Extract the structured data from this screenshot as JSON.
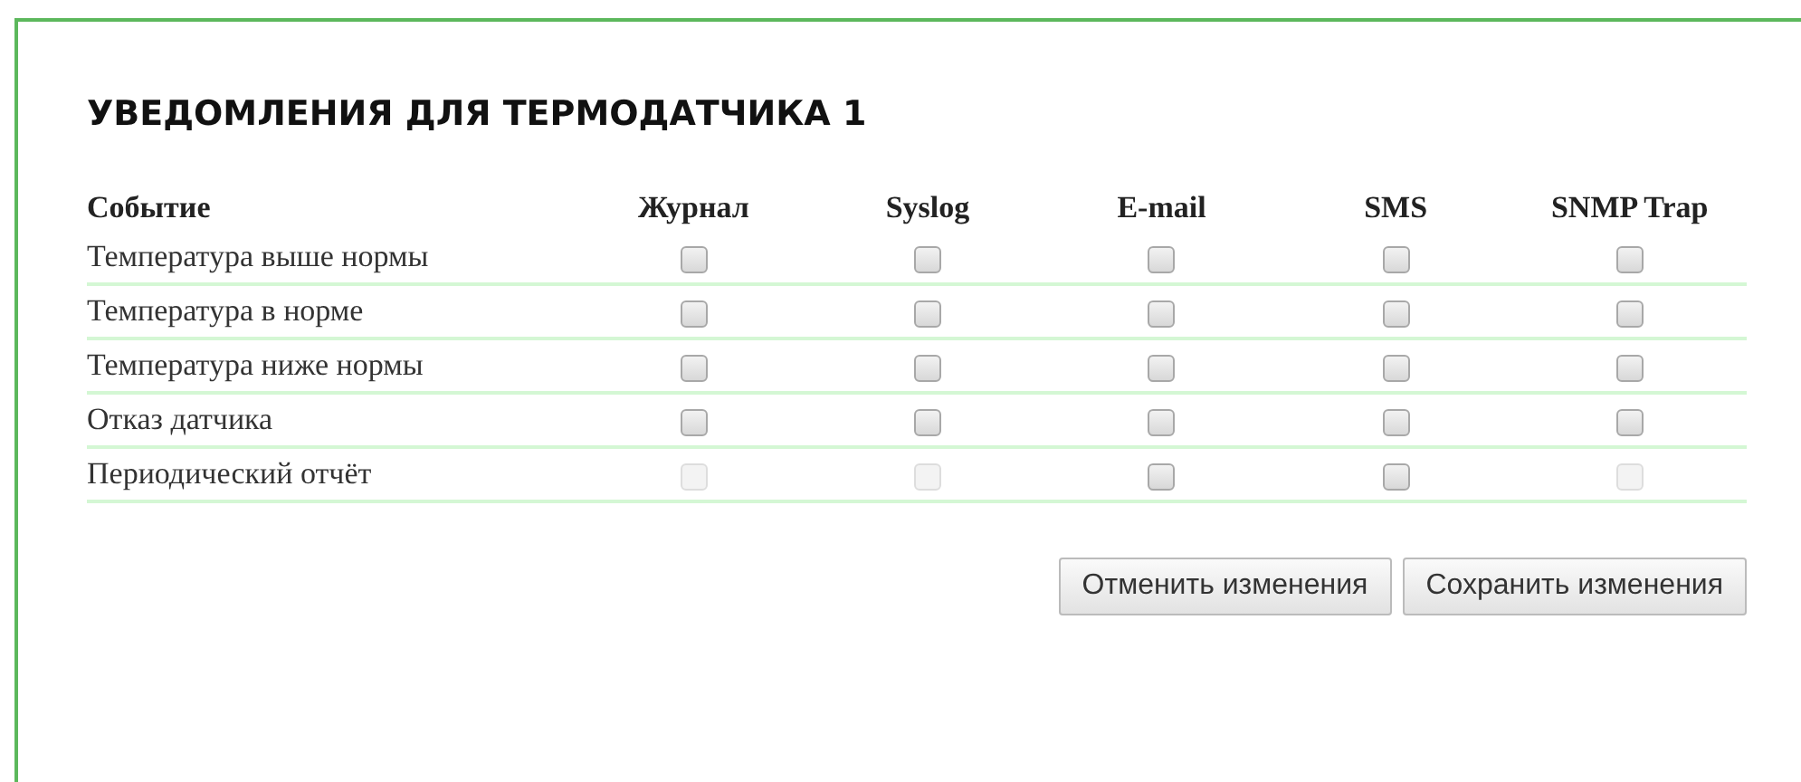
{
  "title": "УВЕДОМЛЕНИЯ ДЛЯ ТЕРМОДАТЧИКА 1",
  "columns": [
    "Событие",
    "Журнал",
    "Syslog",
    "E-mail",
    "SMS",
    "SNMP Trap"
  ],
  "rows": [
    {
      "event": "Температура выше нормы",
      "channels": [
        {
          "checked": false,
          "disabled": false
        },
        {
          "checked": false,
          "disabled": false
        },
        {
          "checked": false,
          "disabled": false
        },
        {
          "checked": false,
          "disabled": false
        },
        {
          "checked": false,
          "disabled": false
        }
      ]
    },
    {
      "event": "Температура в норме",
      "channels": [
        {
          "checked": false,
          "disabled": false
        },
        {
          "checked": false,
          "disabled": false
        },
        {
          "checked": false,
          "disabled": false
        },
        {
          "checked": false,
          "disabled": false
        },
        {
          "checked": false,
          "disabled": false
        }
      ]
    },
    {
      "event": "Температура ниже нормы",
      "channels": [
        {
          "checked": false,
          "disabled": false
        },
        {
          "checked": false,
          "disabled": false
        },
        {
          "checked": false,
          "disabled": false
        },
        {
          "checked": false,
          "disabled": false
        },
        {
          "checked": false,
          "disabled": false
        }
      ]
    },
    {
      "event": "Отказ датчика",
      "channels": [
        {
          "checked": false,
          "disabled": false
        },
        {
          "checked": false,
          "disabled": false
        },
        {
          "checked": false,
          "disabled": false
        },
        {
          "checked": false,
          "disabled": false
        },
        {
          "checked": false,
          "disabled": false
        }
      ]
    },
    {
      "event": "Периодический отчёт",
      "channels": [
        {
          "checked": false,
          "disabled": true
        },
        {
          "checked": false,
          "disabled": true
        },
        {
          "checked": false,
          "disabled": false
        },
        {
          "checked": false,
          "disabled": false
        },
        {
          "checked": false,
          "disabled": true
        }
      ]
    }
  ],
  "buttons": [
    "Отменить изменения",
    "Сохранить изменения"
  ]
}
